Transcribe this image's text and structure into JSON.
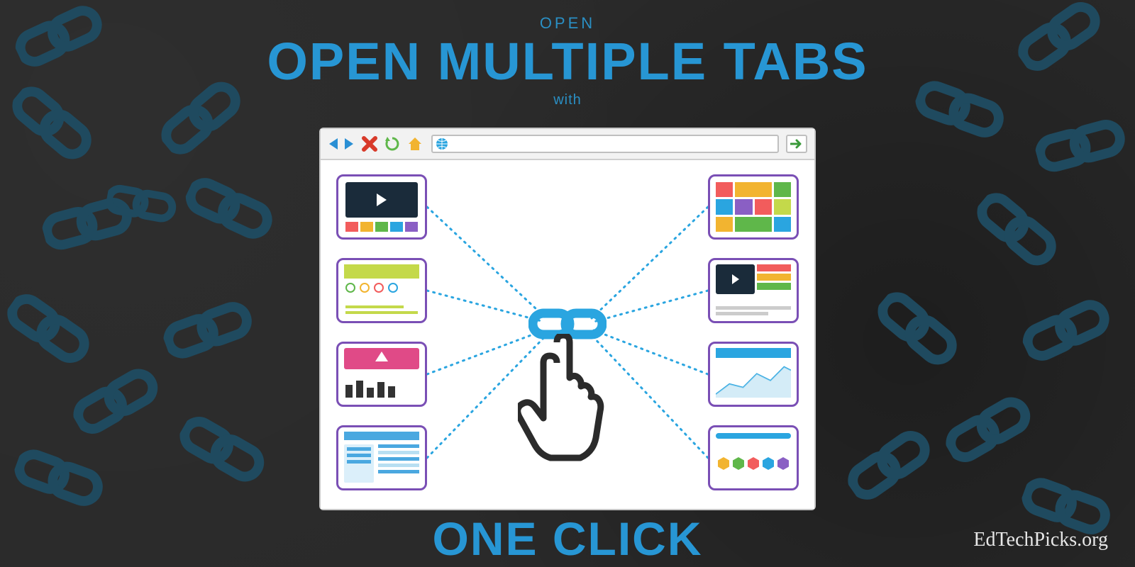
{
  "text": {
    "small_top": "OPEN",
    "big_title": "OPEN MULTIPLE TABS",
    "with": "with",
    "bottom": "ONE CLICK",
    "attribution": "EdTechPicks.org"
  },
  "colors": {
    "accent": "#2796d4",
    "bg": "#2a2a2a",
    "thumb_border": "#7a4fb5"
  },
  "icons": {
    "chain": "chain-link-icon",
    "back": "arrow-left-icon",
    "forward": "arrow-right-icon",
    "close": "close-x-icon",
    "refresh": "refresh-icon",
    "home": "home-icon",
    "globe": "globe-icon",
    "go": "arrow-go-icon",
    "hand": "hand-pointer-icon"
  }
}
